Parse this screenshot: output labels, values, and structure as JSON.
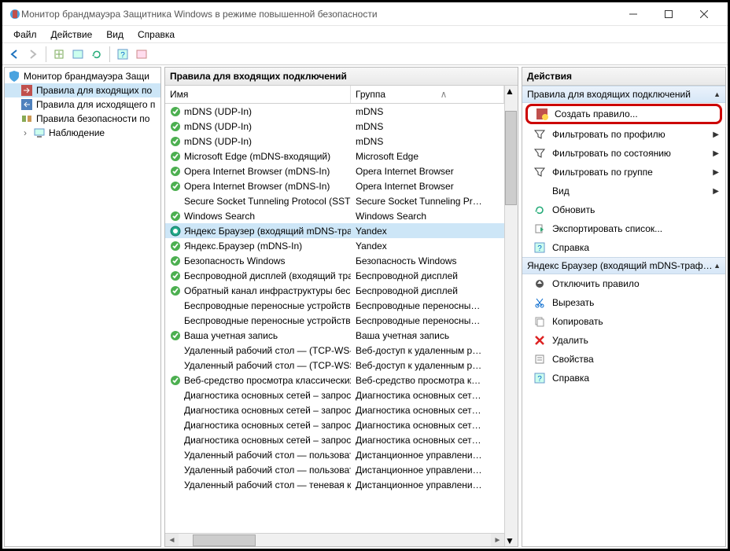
{
  "window": {
    "title": "Монитор брандмауэра Защитника Windows в режиме повышенной безопасности"
  },
  "menu": {
    "file": "Файл",
    "action": "Действие",
    "view": "Вид",
    "help": "Справка"
  },
  "tree": {
    "root": "Монитор брандмауэра Защи",
    "in_rules": "Правила для входящих по",
    "out_rules": "Правила для исходящего п",
    "sec_rules": "Правила безопасности по",
    "monitoring": "Наблюдение"
  },
  "rules_header": {
    "title": "Правила для входящих подключений",
    "name_col": "Имя",
    "group_col": "Группа"
  },
  "rules": [
    {
      "on": true,
      "name": "mDNS (UDP-In)",
      "group": "mDNS"
    },
    {
      "on": true,
      "name": "mDNS (UDP-In)",
      "group": "mDNS"
    },
    {
      "on": true,
      "name": "mDNS (UDP-In)",
      "group": "mDNS"
    },
    {
      "on": true,
      "name": "Microsoft Edge (mDNS-входящий)",
      "group": "Microsoft Edge"
    },
    {
      "on": true,
      "name": "Opera Internet Browser (mDNS-In)",
      "group": "Opera Internet Browser"
    },
    {
      "on": true,
      "name": "Opera Internet Browser (mDNS-In)",
      "group": "Opera Internet Browser"
    },
    {
      "on": false,
      "name": "Secure Socket Tunneling Protocol (SSTP-…",
      "group": "Secure Socket Tunneling Pr…"
    },
    {
      "on": true,
      "name": "Windows Search",
      "group": "Windows Search"
    },
    {
      "on": true,
      "sel": true,
      "name": "Яндекс Браузер (входящий mDNS-траф…",
      "group": "Yandex"
    },
    {
      "on": true,
      "name": "Яндекс.Браузер (mDNS-In)",
      "group": "Yandex"
    },
    {
      "on": true,
      "name": "Безопасность Windows",
      "group": "Безопасность Windows"
    },
    {
      "on": true,
      "name": "Беспроводной дисплей (входящий тра…",
      "group": "Беспроводной дисплей"
    },
    {
      "on": true,
      "name": "Обратный канал инфраструктуры бесп…",
      "group": "Беспроводной дисплей"
    },
    {
      "on": false,
      "name": "Беспроводные переносные устройства…",
      "group": "Беспроводные переносны…"
    },
    {
      "on": false,
      "name": "Беспроводные переносные устройства…",
      "group": "Беспроводные переносны…"
    },
    {
      "on": true,
      "name": "Ваша учетная запись",
      "group": "Ваша учетная запись"
    },
    {
      "on": false,
      "name": "Удаленный рабочий стол — (TCP-WS-In)",
      "group": "Веб-доступ к удаленным р…"
    },
    {
      "on": false,
      "name": "Удаленный рабочий стол — (TCP-WSS …",
      "group": "Веб-доступ к удаленным р…"
    },
    {
      "on": true,
      "name": "Веб-средство просмотра классических…",
      "group": "Веб-средство просмотра к…"
    },
    {
      "on": false,
      "name": "Диагностика основных сетей – запрос …",
      "group": "Диагностика основных сет…"
    },
    {
      "on": false,
      "name": "Диагностика основных сетей – запрос …",
      "group": "Диагностика основных сет…"
    },
    {
      "on": false,
      "name": "Диагностика основных сетей – запрос …",
      "group": "Диагностика основных сет…"
    },
    {
      "on": false,
      "name": "Диагностика основных сетей – запрос …",
      "group": "Диагностика основных сет…"
    },
    {
      "on": false,
      "name": "Удаленный рабочий стол — пользоват…",
      "group": "Дистанционное управлени…"
    },
    {
      "on": false,
      "name": "Удаленный рабочий стол — пользоват…",
      "group": "Дистанционное управлени…"
    },
    {
      "on": false,
      "name": "Удаленный рабочий стол — теневая ко…",
      "group": "Дистанционное управлени…"
    }
  ],
  "actions": {
    "header": "Действия",
    "section1": {
      "title": "Правила для входящих подключений",
      "create_rule": "Создать правило...",
      "filter_profile": "Фильтровать по профилю",
      "filter_state": "Фильтровать по состоянию",
      "filter_group": "Фильтровать по группе",
      "view": "Вид",
      "refresh": "Обновить",
      "export": "Экспортировать список...",
      "help": "Справка"
    },
    "section2": {
      "title": "Яндекс Браузер (входящий mDNS-траф…",
      "disable": "Отключить правило",
      "cut": "Вырезать",
      "copy": "Копировать",
      "delete": "Удалить",
      "props": "Свойства",
      "help": "Справка"
    }
  }
}
